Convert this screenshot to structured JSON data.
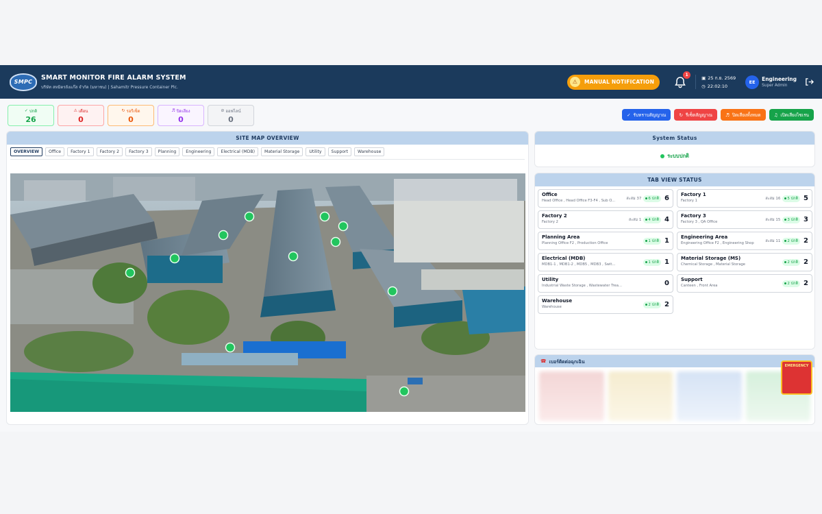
{
  "header": {
    "logo_text": "SMPC",
    "title": "SMART MONITOR FIRE ALARM SYSTEM",
    "subtitle": "บริษัท สหมิตรถังแก๊ส จำกัด (มหาชน) | Sahamitr Pressure Container Plc.",
    "manual_button": "MANUAL NOTIFICATION",
    "notification_count": "1",
    "date": "25 ก.ย. 2569",
    "time": "22:02:10",
    "user_initials": "EE",
    "user_name": "Engineering",
    "user_role": "Super Admin"
  },
  "counters": [
    {
      "label": "ปกติ",
      "value": "26"
    },
    {
      "label": "เตือน",
      "value": "0"
    },
    {
      "label": "รอรีเซ็ต",
      "value": "0"
    },
    {
      "label": "ปิดเสียง",
      "value": "0"
    },
    {
      "label": "ออฟไลน์",
      "value": "0"
    }
  ],
  "actions": {
    "acknowledge": "รับทราบสัญญาณ",
    "reset": "รีเซ็ตสัญญาณ",
    "mute_all": "ปิดเสียงทั้งหมด",
    "unmute": "เปิดเสียงไซเรน"
  },
  "sitemap": {
    "title": "SITE MAP OVERVIEW",
    "tabs": [
      "OVERVIEW",
      "Office",
      "Factory 1",
      "Factory 2",
      "Factory 3",
      "Planning",
      "Engineering",
      "Electrical (MDB)",
      "Material Storage",
      "Utility",
      "Support",
      "Warehouse"
    ],
    "active_tab": "OVERVIEW",
    "marker_status_color": "#22c55e"
  },
  "system_status": {
    "title": "System Status",
    "value": "ระบบปกติ"
  },
  "tab_view": {
    "title": "TAB VIEW STATUS",
    "zones": [
      {
        "name": "Office",
        "sub": "Head Office , Head Office F3-F4 , Sub O...",
        "acc": "สะสม 37",
        "normal": "6 ปกติ",
        "total": "6"
      },
      {
        "name": "Factory 1",
        "sub": "Factory 1",
        "acc": "สะสม 16",
        "normal": "5 ปกติ",
        "total": "5"
      },
      {
        "name": "Factory 2",
        "sub": "Factory 2",
        "acc": "สะสม 1",
        "normal": "4 ปกติ",
        "total": "4"
      },
      {
        "name": "Factory 3",
        "sub": "Factory 3 , QA Office",
        "acc": "สะสม 15",
        "normal": "3 ปกติ",
        "total": "3"
      },
      {
        "name": "Planning Area",
        "sub": "Planning Office F2 , Production Office",
        "acc": "",
        "normal": "1 ปกติ",
        "total": "1"
      },
      {
        "name": "Engineering Area",
        "sub": "Engineering Office F2 , Engineering Shop",
        "acc": "สะสม 11",
        "normal": "2 ปกติ",
        "total": "2"
      },
      {
        "name": "Electrical (MDB)",
        "sub": "MDB1-1 , MDB1-2 , MDB5 , MDB3 , Swit...",
        "acc": "",
        "normal": "1 ปกติ",
        "total": "1"
      },
      {
        "name": "Material Storage (MS)",
        "sub": "Chemical Storage , Material Storage",
        "acc": "",
        "normal": "2 ปกติ",
        "total": "2"
      },
      {
        "name": "Utility",
        "sub": "Industrial Waste Storage , Wastewater Treatment",
        "acc": "",
        "normal": "",
        "total": "0"
      },
      {
        "name": "Support",
        "sub": "Canteen , Front Area",
        "acc": "",
        "normal": "2 ปกติ",
        "total": "2"
      },
      {
        "name": "Warehouse",
        "sub": "Warehouse",
        "acc": "",
        "normal": "2 ปกติ",
        "total": "2"
      }
    ]
  },
  "emergency": {
    "title": "เบอร์ติดต่อฉุกเฉิน",
    "badge": "EMERGENCY"
  },
  "colors": {
    "header_bg": "#1b3a5c",
    "panel_head": "#bcd3ec",
    "normal": "#16a34a",
    "manual_button": "#f59e0b"
  }
}
